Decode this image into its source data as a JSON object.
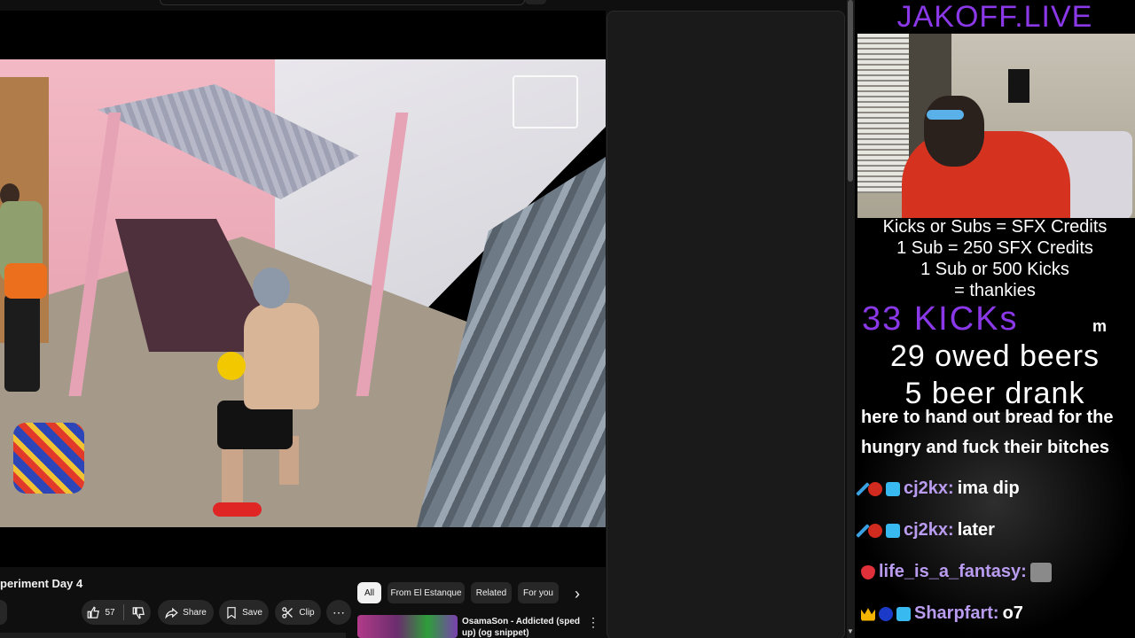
{
  "youtube": {
    "video_title": "periment Day 4",
    "actions": {
      "like_count": "57",
      "share": "Share",
      "save": "Save",
      "clip": "Clip"
    },
    "chips": [
      "All",
      "From El Estanque",
      "Related",
      "For you"
    ],
    "recommended": [
      {
        "title": "OsamaSon - Addicted (sped up) (og snippet)"
      }
    ]
  },
  "stream": {
    "title": "JAKOFF.LIVE",
    "rules": [
      "Kicks or Subs = SFX Credits",
      "1 Sub = 250 SFX Credits",
      "1 Sub or 500 Kicks",
      "= thankies"
    ],
    "kicks": "33 KICKs",
    "kicks_suffix": "m",
    "owed_beers": "29 owed beers",
    "beers_drank": "5 beer drank",
    "announcement_line1": "here to hand out bread for the",
    "announcement_line2": "hungry and fuck their bitches",
    "chat": [
      {
        "user": "cj2kx:",
        "text": "ima dip"
      },
      {
        "user": "cj2kx:",
        "text": "later"
      },
      {
        "user": "life_is_a_fantasy:",
        "text": ""
      },
      {
        "user": "Sharpfart:",
        "text": "o7"
      }
    ],
    "colors": {
      "accent": "#8a38e8",
      "chat_user": "#b99cf0"
    }
  }
}
